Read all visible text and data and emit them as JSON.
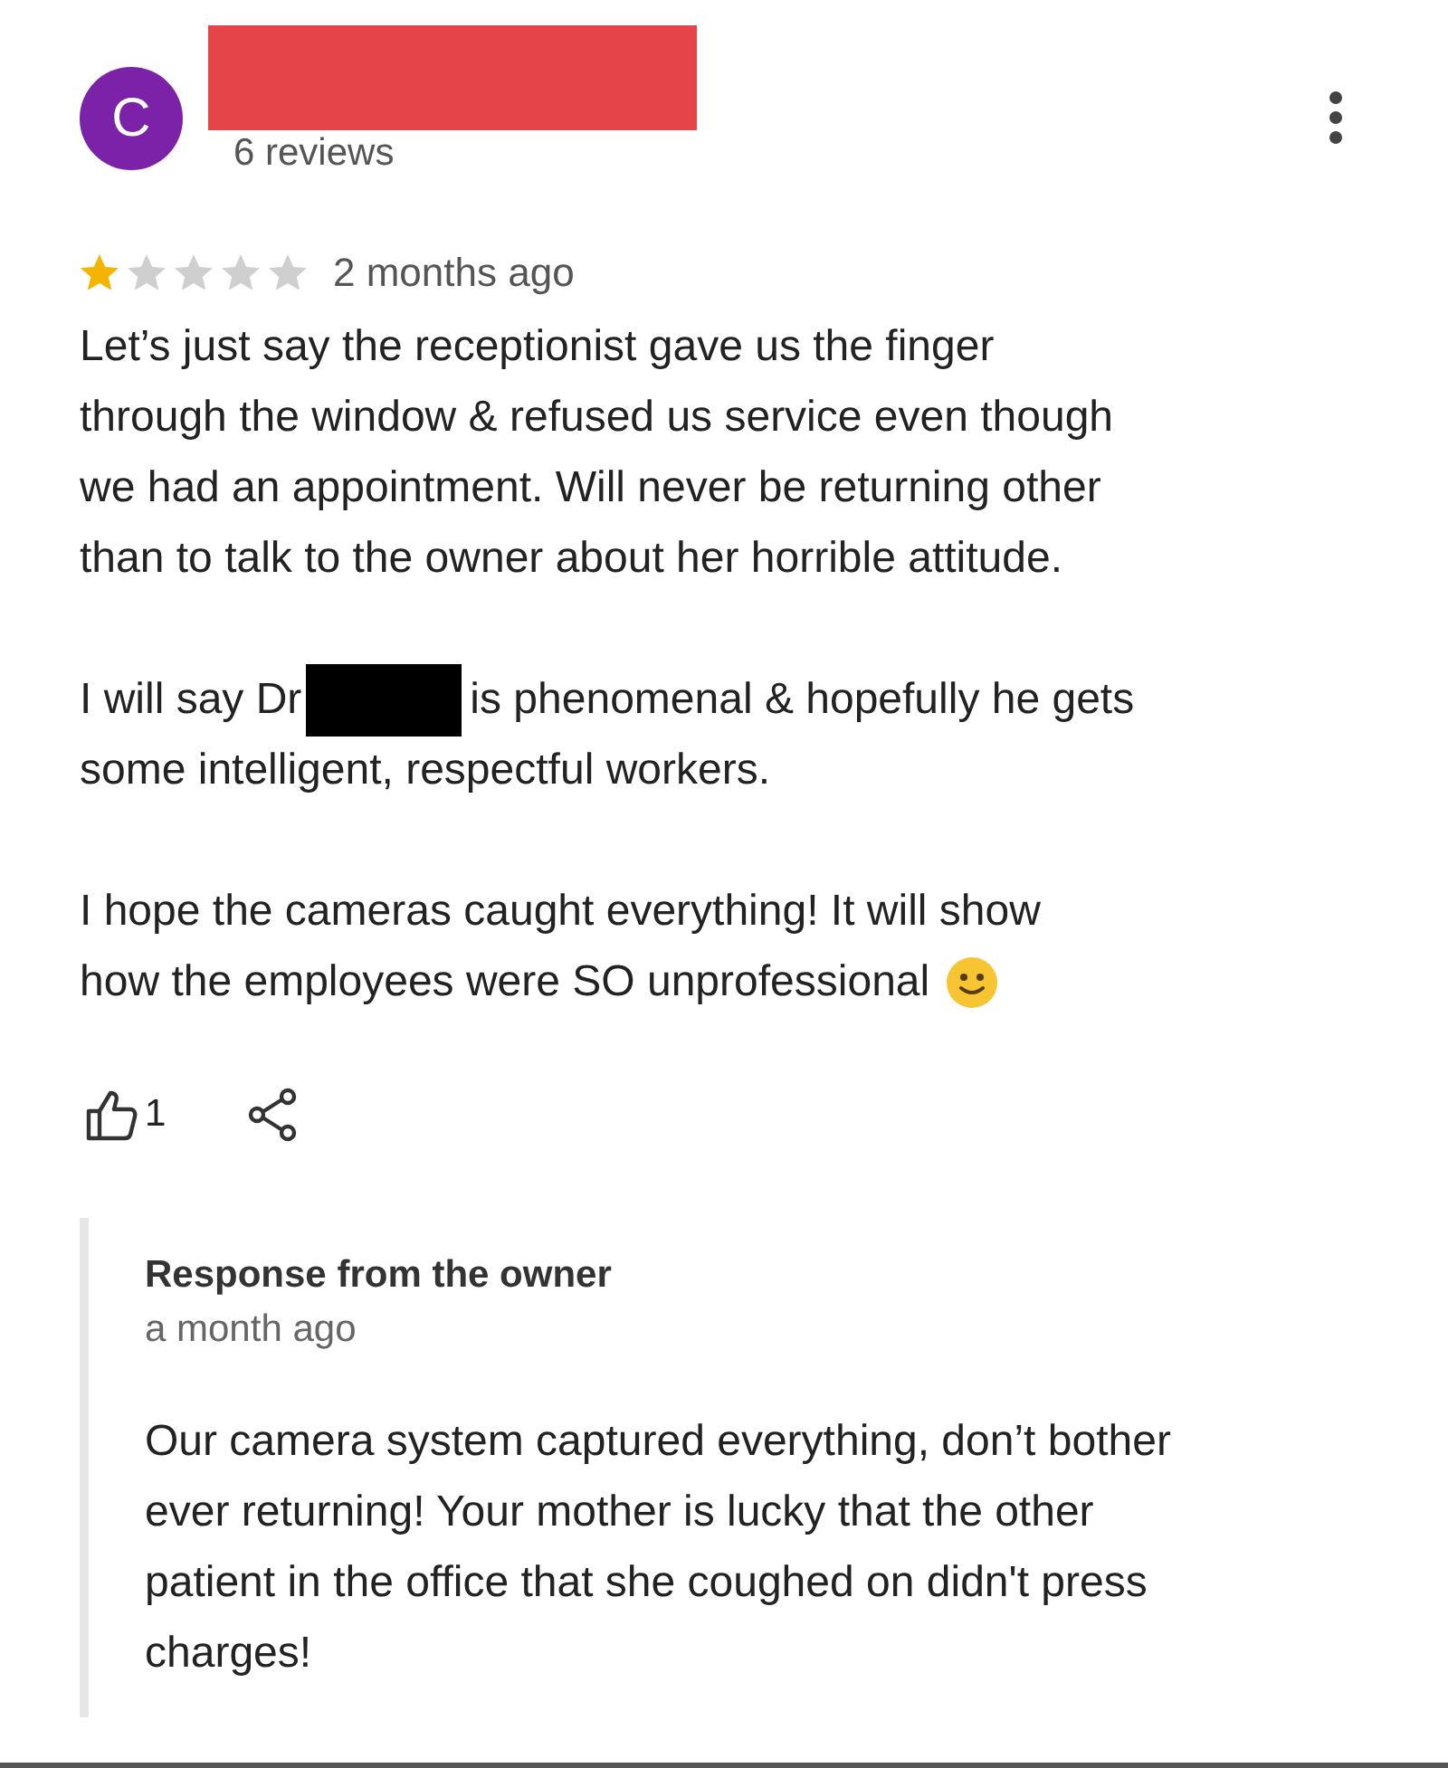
{
  "reviewer": {
    "initial": "C",
    "name_redacted": true,
    "review_count": "6 reviews"
  },
  "review": {
    "stars": 1,
    "time": "2 months ago",
    "paragraphs": [
      {
        "lines": [
          {
            "kind": "text",
            "text": "Let’s just say the receptionist gave us the finger"
          },
          {
            "kind": "text",
            "text": "through the window & refused us service even though"
          },
          {
            "kind": "text",
            "text": "we had an appointment. Will never be returning other"
          },
          {
            "kind": "text",
            "text": "than to talk to the owner about her horrible attitude."
          }
        ]
      },
      {
        "lines": [
          {
            "kind": "redacted",
            "before": "I will say Dr",
            "after": "is phenomenal & hopefully he gets"
          },
          {
            "kind": "text",
            "text": "some intelligent, respectful workers."
          }
        ]
      },
      {
        "lines": [
          {
            "kind": "text",
            "text": "I hope the cameras caught everything! It will show"
          },
          {
            "kind": "smiley",
            "text": "how the employees were SO unprofessional"
          }
        ]
      }
    ]
  },
  "actions": {
    "likes": "1"
  },
  "owner_response": {
    "title": "Response from the owner",
    "time": "a month ago",
    "lines": [
      "Our camera system captured everything, don’t bother",
      "ever returning! Your mother is lucky that the other",
      "patient in the office that she coughed on didn't press",
      "charges!"
    ]
  }
}
